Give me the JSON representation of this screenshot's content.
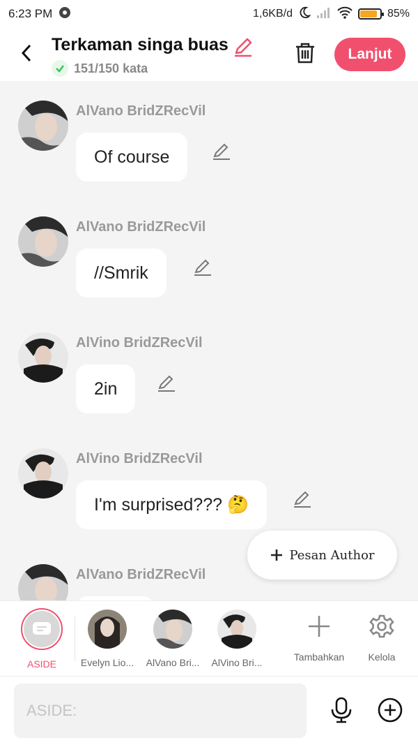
{
  "status": {
    "time": "6:23 PM",
    "network_speed": "1,6KB/d",
    "battery": "85%",
    "battery_level": 0.85
  },
  "header": {
    "title": "Terkaman singa buas",
    "word_count": "151/150 kata",
    "next_label": "Lanjut"
  },
  "messages": [
    {
      "sender": "AlVano BridZRecVil",
      "text": "Of course"
    },
    {
      "sender": "AlVano BridZRecVil",
      "text": "//Smrik"
    },
    {
      "sender": "AlVino BridZRecVil",
      "text": "2in"
    },
    {
      "sender": "AlVino BridZRecVil",
      "text": "I'm surprised??? 🤔"
    },
    {
      "sender": "AlVano BridZRecVil",
      "text": ""
    }
  ],
  "author_button": "Pesan Author",
  "characters": [
    {
      "label": "ASIDE"
    },
    {
      "label": "Evelyn Lio..."
    },
    {
      "label": "AlVano Bri..."
    },
    {
      "label": "AlVino Bri..."
    }
  ],
  "tools": {
    "add_label": "Tambahkan",
    "manage_label": "Kelola"
  },
  "composer": {
    "placeholder": "ASIDE:"
  },
  "colors": {
    "accent": "#f0506e",
    "chat_background": "#f4f4f4",
    "battery": "#f5a623",
    "check": "#34c759"
  }
}
